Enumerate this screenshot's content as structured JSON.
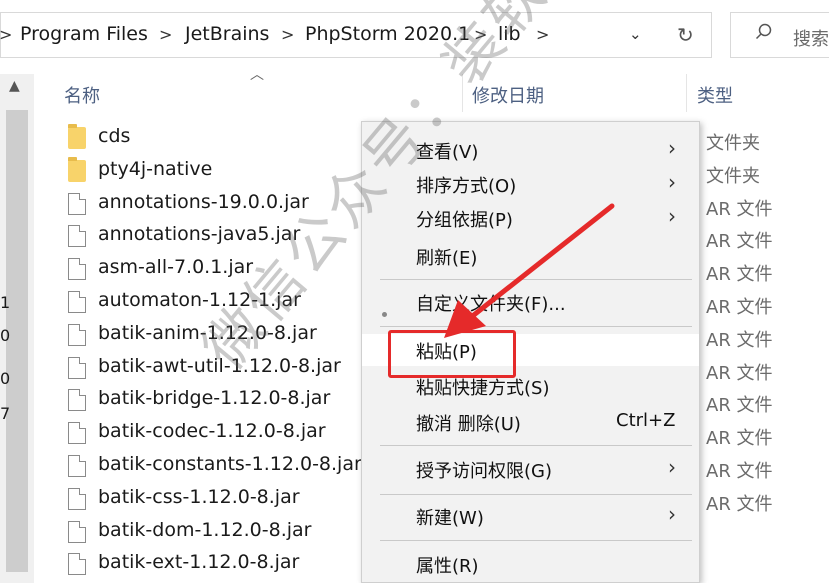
{
  "address_bar": {
    "crumbs": [
      "Program Files",
      "JetBrains",
      "PhpStorm 2020.1",
      "lib"
    ],
    "separator": ">",
    "dropdown": "⌄",
    "refresh": "↻"
  },
  "search": {
    "placeholder": "搜索"
  },
  "edge_chars": [
    "1",
    "0",
    "0",
    "7"
  ],
  "columns": {
    "name": "名称",
    "modified": "修改日期",
    "type": "类型"
  },
  "files": [
    {
      "name": "cds",
      "kind": "folder",
      "type": "文件夹"
    },
    {
      "name": "pty4j-native",
      "kind": "folder",
      "type": "文件夹"
    },
    {
      "name": "annotations-19.0.0.jar",
      "kind": "file",
      "type": "AR 文件"
    },
    {
      "name": "annotations-java5.jar",
      "kind": "file",
      "type": "AR 文件"
    },
    {
      "name": "asm-all-7.0.1.jar",
      "kind": "file",
      "type": "AR 文件"
    },
    {
      "name": "automaton-1.12-1.jar",
      "kind": "file",
      "type": "AR 文件"
    },
    {
      "name": "batik-anim-1.12.0-8.jar",
      "kind": "file",
      "type": "AR 文件"
    },
    {
      "name": "batik-awt-util-1.12.0-8.jar",
      "kind": "file",
      "type": "AR 文件"
    },
    {
      "name": "batik-bridge-1.12.0-8.jar",
      "kind": "file",
      "type": "AR 文件"
    },
    {
      "name": "batik-codec-1.12.0-8.jar",
      "kind": "file",
      "type": "AR 文件"
    },
    {
      "name": "batik-constants-1.12.0-8.jar",
      "kind": "file",
      "type": "AR 文件"
    },
    {
      "name": "batik-css-1.12.0-8.jar",
      "kind": "file",
      "type": "AR 文件"
    },
    {
      "name": "batik-dom-1.12.0-8.jar",
      "kind": "file",
      "type": ""
    },
    {
      "name": "batik-ext-1.12.0-8.jar",
      "kind": "file",
      "type": ""
    }
  ],
  "context_menu": {
    "view": "查看(V)",
    "sort": "排序方式(O)",
    "group": "分组依据(P)",
    "refresh": "刷新(E)",
    "customize": "自定义文件夹(F)...",
    "paste": "粘贴(P)",
    "paste_shortcut": "粘贴快捷方式(S)",
    "undo": "撤消 删除(U)",
    "undo_shortcut": "Ctrl+Z",
    "grant_access": "授予访问权限(G)",
    "new": "新建(W)",
    "properties": "属性(R)",
    "submenu_arrow": "›"
  },
  "watermark": "微信公众号：装软件指南",
  "colors": {
    "highlight_box": "#e52a2a",
    "arrow": "#e52a2a",
    "header_text": "#4d6082"
  }
}
